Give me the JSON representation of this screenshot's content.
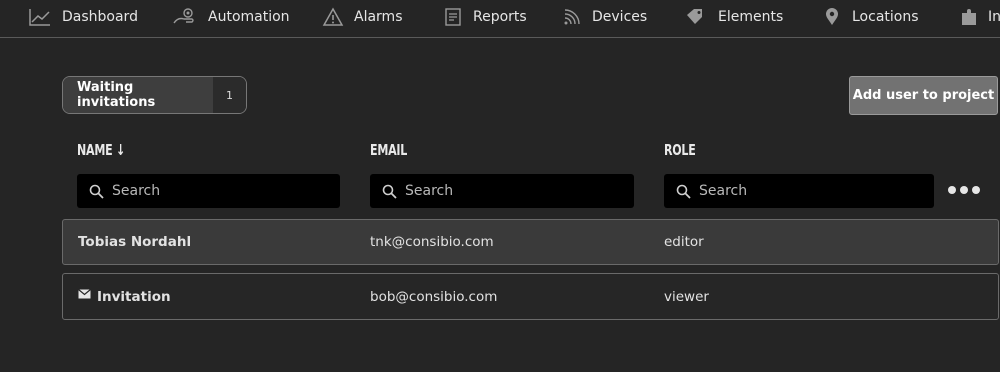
{
  "nav": {
    "items": [
      {
        "label": "Dashboard",
        "icon": "chart-line-icon"
      },
      {
        "label": "Automation",
        "icon": "hand-gear-icon"
      },
      {
        "label": "Alarms",
        "icon": "warning-triangle-icon"
      },
      {
        "label": "Reports",
        "icon": "report-document-icon"
      },
      {
        "label": "Devices",
        "icon": "signal-waves-icon"
      },
      {
        "label": "Elements",
        "icon": "tags-icon"
      },
      {
        "label": "Locations",
        "icon": "map-pin-icon"
      },
      {
        "label": "In",
        "icon": "puzzle-piece-icon"
      }
    ]
  },
  "waiting": {
    "label": "Waiting invitations",
    "count": "1"
  },
  "add_user_label": "Add user to project",
  "columns": {
    "name": "NAME ↓",
    "email": "EMAIL",
    "role": "ROLE"
  },
  "search": {
    "placeholder": "Search"
  },
  "rows": [
    {
      "name": "Tobias Nordahl",
      "email": "tnk@consibio.com",
      "role": "editor",
      "icon": ""
    },
    {
      "name": "Invitation",
      "email": "bob@consibio.com",
      "role": "viewer",
      "icon": "envelope-icon"
    }
  ],
  "colors": {
    "background": "#252525",
    "row_highlight": "#3a3a3a",
    "button": "#727272"
  }
}
